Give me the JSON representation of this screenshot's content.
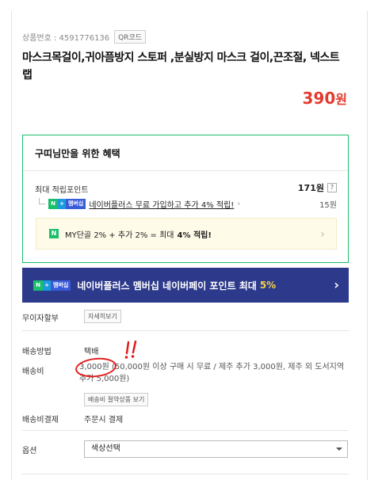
{
  "product": {
    "number_label": "상품번호 : 4591776136",
    "qr_label": "QR코드",
    "title": "마스크목걸이,귀아픔방지 스토퍼 ,분실방지 마스크 걸이,끈조절, 넥스트랩",
    "price": "390",
    "price_unit": "원"
  },
  "benefit": {
    "title": "구띠님만을 위한 혜택",
    "max_points_label": "최대 적립포인트",
    "max_points_value": "171원",
    "help_label": "?",
    "naver_plus_text": "네이버플러스 무료 가입하고 추가 4% 적립!",
    "naver_plus_value": "15원",
    "badge_n": "N",
    "badge_plus": "+",
    "badge_member": "멤버십",
    "my_text": "MY단골 2% + 추가 2% = 최대",
    "my_bold": "4% 적립!"
  },
  "banner": {
    "text": "네이버플러스 멤버십 네이버페이 포인트 최대",
    "accent": "5%"
  },
  "rows": {
    "installment_label": "무이자할부",
    "installment_button": "자세히보기",
    "shipping_method_label": "배송방법",
    "shipping_method_value": "택배",
    "shipping_fee_label": "배송비",
    "shipping_fee_text": "3,000원 (50,000원 이상 구매 시 무료 / 제주 추가 3,000원, 제주 외 도서지역 추가 5,000원)",
    "shipping_saving_button": "배송비 절약상품 보기",
    "shipping_pay_label": "배송비결제",
    "shipping_pay_value": "주문시 결제",
    "option_label": "옵션",
    "option_select": "색상선택"
  },
  "annotation": {
    "marks": "!!"
  },
  "colors": {
    "price": "#e33b2f",
    "green": "#1bbf6b",
    "banner": "#2d3a8c",
    "accent": "#f7d23e",
    "circle": "#e21c1c"
  }
}
